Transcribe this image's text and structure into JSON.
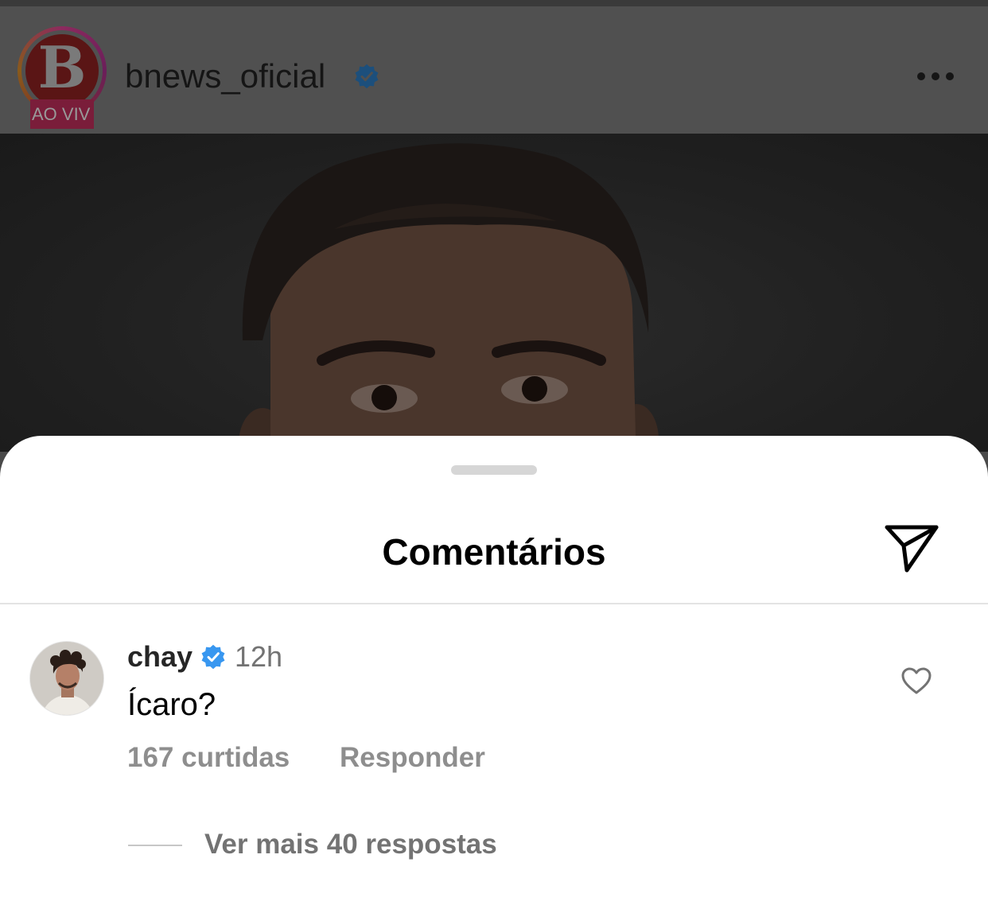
{
  "post": {
    "account_name": "bnews_oficial",
    "avatar_letter": "B",
    "live_badge": "AO VIV",
    "verified_icon": "verified-badge-icon",
    "more_icon": "more-dots-icon"
  },
  "sheet": {
    "title": "Comentários",
    "share_icon": "paper-plane-icon"
  },
  "comment": {
    "username": "chay",
    "time": "12h",
    "text": "Ícaro?",
    "likes": "167 curtidas",
    "reply_label": "Responder",
    "like_icon": "heart-outline-icon",
    "view_replies": "Ver mais 40 respostas"
  },
  "colors": {
    "verified_blue": "#3897f0",
    "sheet_bg": "#ffffff",
    "overlay_dim": "#4a4a4a",
    "secondary_text": "#8e8e8e"
  }
}
